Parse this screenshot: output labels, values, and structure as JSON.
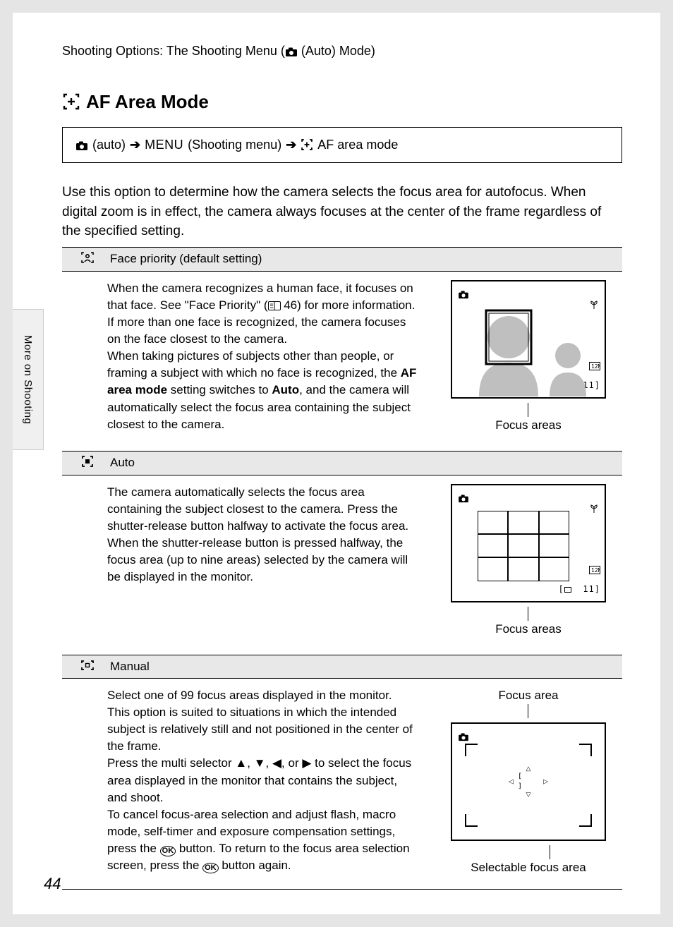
{
  "breadcrumb_top": {
    "prefix": "Shooting Options: The Shooting Menu (",
    "mode_text": " (Auto) Mode)",
    "full_suffix": "(Auto) Mode)"
  },
  "side_tab": "More on Shooting",
  "title": "AF Area Mode",
  "nav": {
    "auto_label": "(auto)",
    "menu_label": "MENU",
    "menu_paren": "(Shooting menu)",
    "af_label": "AF area mode"
  },
  "intro": "Use this option to determine how the camera selects the focus area for autofocus. When digital zoom is in effect, the camera always focuses at the center of the frame regardless of the specified setting.",
  "rows": {
    "face": {
      "header": "Face priority (default setting)",
      "body_1": "When the camera recognizes a human face, it focuses on that face. See \"Face Priority\" (",
      "body_ref": " 46) for more information. If more than one face is recognized, the camera focuses on the face closest to the camera.",
      "body_2a": "When taking pictures of subjects other than people, or framing a subject with which no face is recognized, the ",
      "body_2_bold": "AF area mode",
      "body_2b": " setting switches to ",
      "body_2_bold2": "Auto",
      "body_2c": ", and the camera will automatically select the focus area containing the subject closest to the camera.",
      "caption": "Focus areas"
    },
    "auto": {
      "header": "Auto",
      "body": "The camera automatically selects the focus area containing the subject closest to the camera. Press the shutter-release button halfway to activate the focus area. When the shutter-release button is pressed halfway, the focus area (up to nine areas) selected by the camera will be displayed in the monitor.",
      "caption": "Focus areas"
    },
    "manual": {
      "header": "Manual",
      "body_1": "Select one of 99 focus areas displayed in the monitor. This option is suited to situations in which the intended subject is relatively still and not positioned in the center of the frame.",
      "body_2a": "Press the multi selector ",
      "body_2b": " to select the focus area displayed in the monitor that contains the subject, and shoot.",
      "body_3a": "To cancel focus-area selection and adjust flash, macro mode, self-timer and exposure compensation settings, press the ",
      "body_3b": " button. To return to the focus area selection screen, press the ",
      "body_3c": " button again.",
      "caption_top": "Focus area",
      "caption_bottom": "Selectable focus area"
    }
  },
  "lcd_shots": "11",
  "page_number": "44",
  "glyphs": {
    "ok": "OK",
    "arrows_sep": ", ",
    "arrows_or": ", or "
  }
}
